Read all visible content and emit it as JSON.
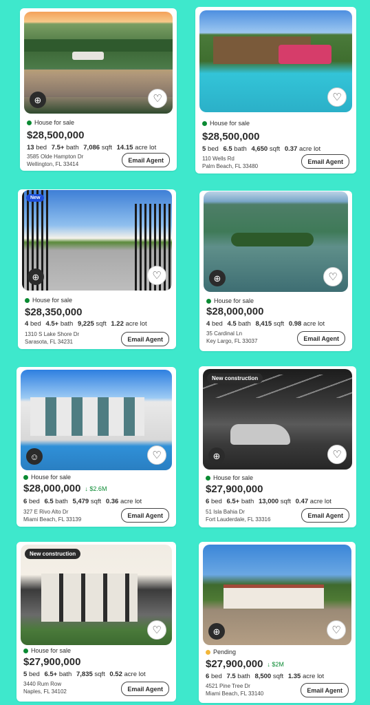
{
  "listings": [
    {
      "status": "House for sale",
      "price": "$28,500,000",
      "beds": "13",
      "beds_label": "bed",
      "baths": "7.5+",
      "baths_label": "bath",
      "sqft": "7,086",
      "sqft_label": "sqft",
      "lot": "14.15",
      "lot_label": "acre lot",
      "address1": "3585 Olde Hampton Dr",
      "address2": "Wellington, FL 33414",
      "email_label": "Email Agent"
    },
    {
      "status": "House for sale",
      "price": "$28,500,000",
      "beds": "5",
      "beds_label": "bed",
      "baths": "6.5",
      "baths_label": "bath",
      "sqft": "4,650",
      "sqft_label": "sqft",
      "lot": "0.37",
      "lot_label": "acre lot",
      "address1": "110 Wells Rd",
      "address2": "Palm Beach, FL 33480",
      "email_label": "Email Agent"
    },
    {
      "tag": "New",
      "status": "House for sale",
      "price": "$28,350,000",
      "beds": "4",
      "beds_label": "bed",
      "baths": "4.5+",
      "baths_label": "bath",
      "sqft": "9,225",
      "sqft_label": "sqft",
      "lot": "1.22",
      "lot_label": "acre lot",
      "address1": "1310 S Lake Shore Dr",
      "address2": "Sarasota, FL 34231",
      "email_label": "Email Agent"
    },
    {
      "status": "House for sale",
      "price": "$28,000,000",
      "beds": "4",
      "beds_label": "bed",
      "baths": "4.5",
      "baths_label": "bath",
      "sqft": "8,415",
      "sqft_label": "sqft",
      "lot": "0.98",
      "lot_label": "acre lot",
      "address1": "35 Cardinal Ln",
      "address2": "Key Largo, FL 33037",
      "email_label": "Email Agent"
    },
    {
      "status": "House for sale",
      "price": "$28,000,000",
      "price_drop": "↓ $2.6M",
      "beds": "6",
      "beds_label": "bed",
      "baths": "6.5",
      "baths_label": "bath",
      "sqft": "5,479",
      "sqft_label": "sqft",
      "lot": "0.36",
      "lot_label": "acre lot",
      "address1": "327 E Rivo Alto Dr",
      "address2": "Miami Beach, FL 33139",
      "email_label": "Email Agent"
    },
    {
      "tag": "New construction",
      "status": "House for sale",
      "price": "$27,900,000",
      "beds": "6",
      "beds_label": "bed",
      "baths": "6.5+",
      "baths_label": "bath",
      "sqft": "13,000",
      "sqft_label": "sqft",
      "lot": "0.47",
      "lot_label": "acre lot",
      "address1": "51 Isla Bahia Dr",
      "address2": "Fort Lauderdale, FL 33316",
      "email_label": "Email Agent"
    },
    {
      "tag": "New construction",
      "status": "House for sale",
      "price": "$27,900,000",
      "beds": "5",
      "beds_label": "bed",
      "baths": "6.5+",
      "baths_label": "bath",
      "sqft": "7,835",
      "sqft_label": "sqft",
      "lot": "0.52",
      "lot_label": "acre lot",
      "address1": "3440 Rum Row",
      "address2": "Naples, FL 34102",
      "email_label": "Email Agent"
    },
    {
      "status": "Pending",
      "price": "$27,900,000",
      "price_drop": "↓ $2M",
      "beds": "6",
      "beds_label": "bed",
      "baths": "7.5",
      "baths_label": "bath",
      "sqft": "8,500",
      "sqft_label": "sqft",
      "lot": "1.35",
      "lot_label": "acre lot",
      "address1": "4521 Pine Tree Dr",
      "address2": "Miami Beach, FL 33140",
      "email_label": "Email Agent"
    }
  ],
  "icons": {
    "globe": "globe-icon",
    "heart": "heart-icon"
  },
  "colors": {
    "background": "#3ee8cc",
    "for_sale_dot": "#0a8a32",
    "pending_dot": "#f2b63a",
    "price_drop": "#0a8a32"
  }
}
